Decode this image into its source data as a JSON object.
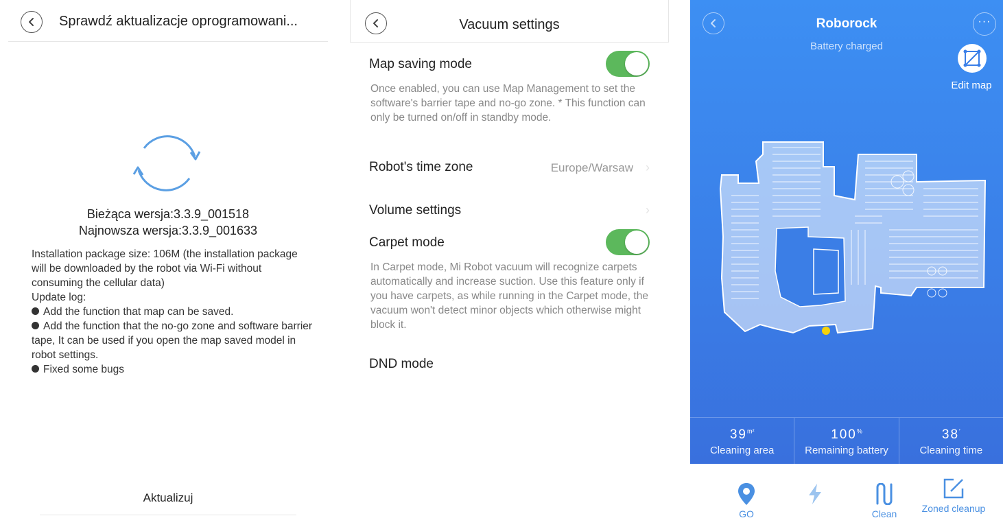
{
  "update_screen": {
    "title": "Sprawdź aktualizacje oprogramowani...",
    "current_version": "Bieżąca wersja:3.3.9_001518",
    "latest_version": "Najnowsza wersja:3.3.9_001633",
    "package_info": "Installation package size: 106M (the installation package will be downloaded by the robot via Wi-Fi without consuming the cellular data)",
    "log_title": "Update log:",
    "log_items": [
      "Add the function that map can be saved.",
      "Add the function that the no-go zone and software barrier tape,  It can be used if you open the map saved model in robot settings.",
      "Fixed some bugs"
    ],
    "update_button": "Aktualizuj",
    "accent_color": "#5b9fe3"
  },
  "settings_screen": {
    "title": "Vacuum settings",
    "map_saving": {
      "label": "Map saving mode",
      "description": " Once enabled, you can use Map Management to set the software's barrier tape and no-go zone. * This function can only be turned on/off in standby mode.",
      "enabled": true
    },
    "time_zone": {
      "label": "Robot's time zone",
      "value": "Europe/Warsaw"
    },
    "volume": {
      "label": "Volume settings"
    },
    "carpet": {
      "label": "Carpet mode",
      "description": " In Carpet mode, Mi Robot vacuum will recognize carpets automatically and increase suction. Use this feature only if you have carpets, as while running in the Carpet mode, the vacuum won't detect minor objects which otherwise might block it.",
      "enabled": true
    },
    "dnd": {
      "label": "DND mode"
    },
    "toggle_color": "#5cb85c"
  },
  "robot_screen": {
    "title": "Roborock",
    "status": "Battery charged",
    "edit_map": "Edit map",
    "stats": [
      {
        "value": "39",
        "unit": "m²",
        "label": "Cleaning area"
      },
      {
        "value": "100",
        "unit": "%",
        "label": "Remaining battery"
      },
      {
        "value": "38",
        "unit": "′",
        "label": "Cleaning time"
      }
    ],
    "nav": [
      {
        "label": "GO",
        "icon": "location-pin-icon"
      },
      {
        "label": "",
        "icon": "lightning-icon"
      },
      {
        "label": "Clean",
        "icon": "clean-path-icon"
      },
      {
        "label": "Zoned cleanup",
        "icon": "edit-square-icon"
      }
    ],
    "background_color": "#3a7fe8"
  }
}
